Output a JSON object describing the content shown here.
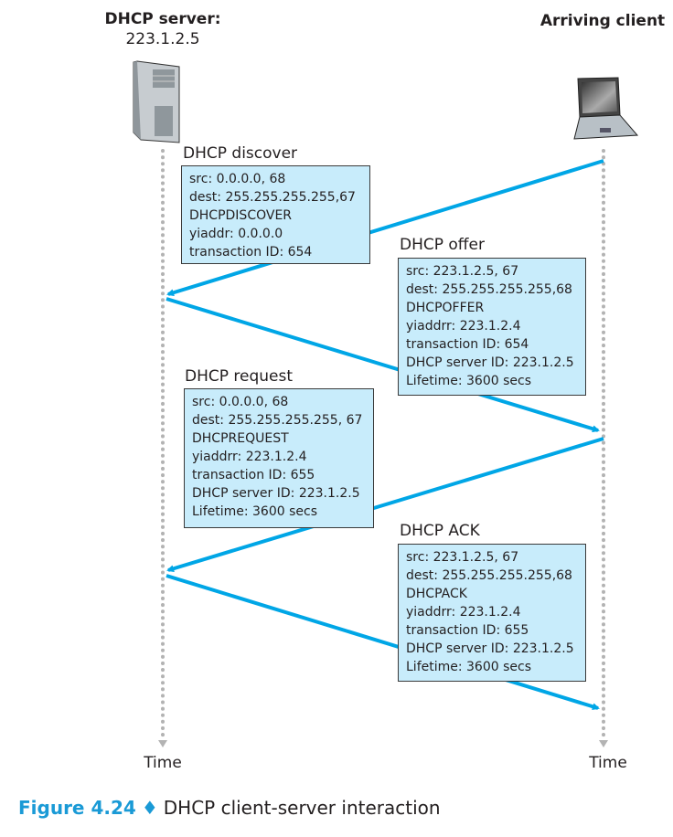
{
  "server": {
    "title": "DHCP server:",
    "ip": "223.1.2.5"
  },
  "client": {
    "title": "Arriving client"
  },
  "time_label": "Time",
  "messages": [
    {
      "label": "DHCP discover",
      "lines": [
        "src: 0.0.0.0, 68",
        "dest: 255.255.255.255,67",
        "DHCPDISCOVER",
        "yiaddr: 0.0.0.0",
        "transaction ID: 654"
      ]
    },
    {
      "label": "DHCP offer",
      "lines": [
        "src: 223.1.2.5, 67",
        "dest: 255.255.255.255,68",
        "DHCPOFFER",
        "yiaddrr: 223.1.2.4",
        "transaction ID: 654",
        "DHCP server ID: 223.1.2.5",
        "Lifetime: 3600 secs"
      ]
    },
    {
      "label": "DHCP request",
      "lines": [
        "src: 0.0.0.0, 68",
        "dest: 255.255.255.255, 67",
        "DHCPREQUEST",
        "yiaddrr: 223.1.2.4",
        "transaction ID: 655",
        "DHCP server ID: 223.1.2.5",
        "Lifetime: 3600 secs"
      ]
    },
    {
      "label": "DHCP ACK",
      "lines": [
        "src: 223.1.2.5, 67",
        "dest: 255.255.255.255,68",
        "DHCPACK",
        "yiaddrr: 223.1.2.4",
        "transaction ID: 655",
        "DHCP server ID: 223.1.2.5",
        "Lifetime: 3600 secs"
      ]
    }
  ],
  "caption": {
    "number": "Figure 4.24",
    "separator": "♦",
    "text": "DHCP client-server interaction"
  },
  "colors": {
    "arrow": "#00a6e6",
    "box": "#c8ecfb",
    "accent": "#1a9ad6"
  }
}
